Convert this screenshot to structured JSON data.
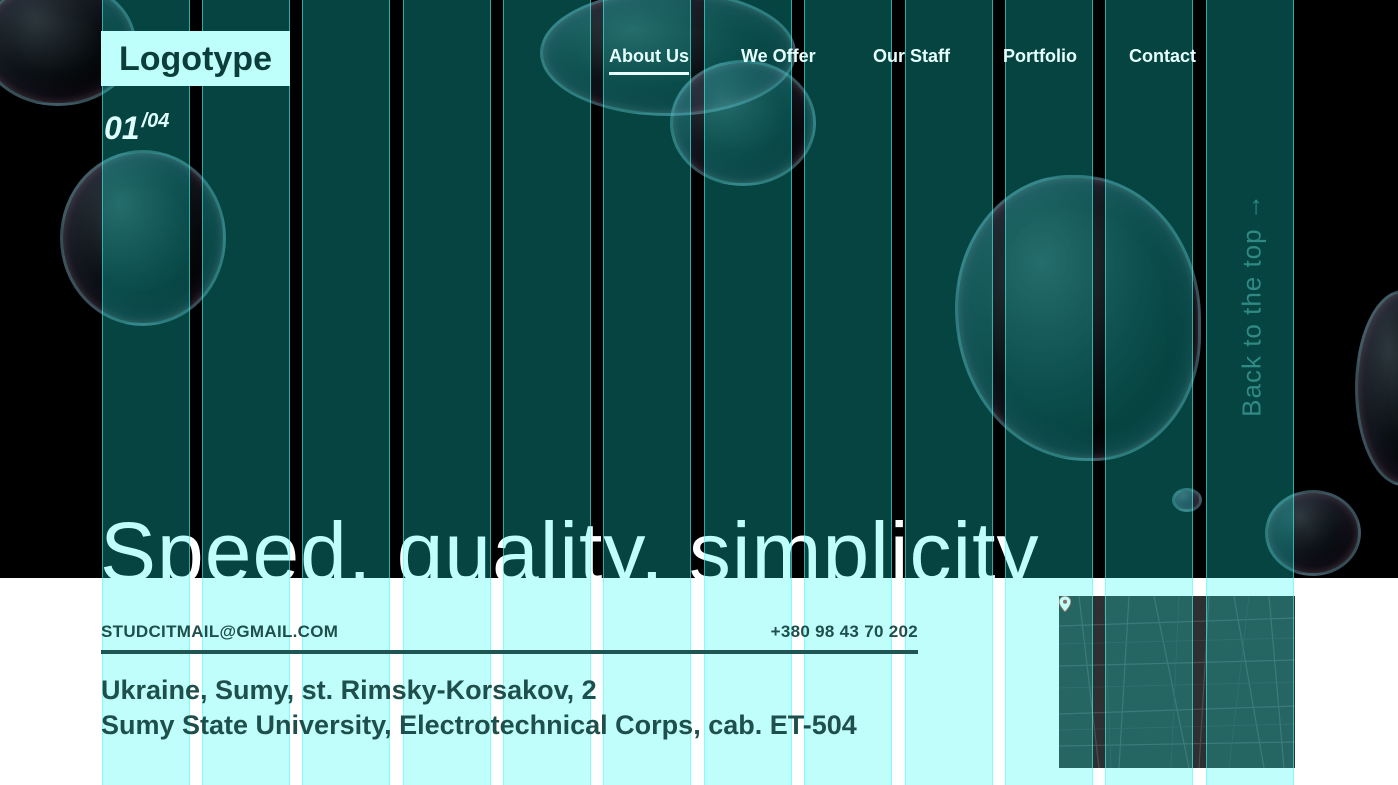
{
  "header": {
    "logo": "Logotype",
    "slide_current": "01",
    "slide_separator": "/",
    "slide_total": "04"
  },
  "nav": {
    "items": [
      {
        "label": "About Us",
        "active": true
      },
      {
        "label": "We Offer",
        "active": false
      },
      {
        "label": "Our Staff",
        "active": false
      },
      {
        "label": "Portfolio",
        "active": false
      },
      {
        "label": "Contact",
        "active": false
      }
    ]
  },
  "hero": {
    "title": "Speed, quality, simplicity",
    "back_to_top": "Back to the top →"
  },
  "footer": {
    "email": "STUDCITMAIL@GMAIL.COM",
    "phone": "+380 98 43 70 202",
    "address_line1": "Ukraine, Sumy, st. Rimsky-Korsakov, 2",
    "address_line2": "Sumy State University, Electrotechnical Corps, cab. ET-504"
  },
  "colors": {
    "grid_overlay": "#12faee",
    "logo_bg": "#bffffb",
    "text_dark": "#1e4f4c",
    "hero_bg": "#000000"
  },
  "icons": {
    "map_pin": "map-pin-icon",
    "arrow": "arrow-right-icon"
  }
}
